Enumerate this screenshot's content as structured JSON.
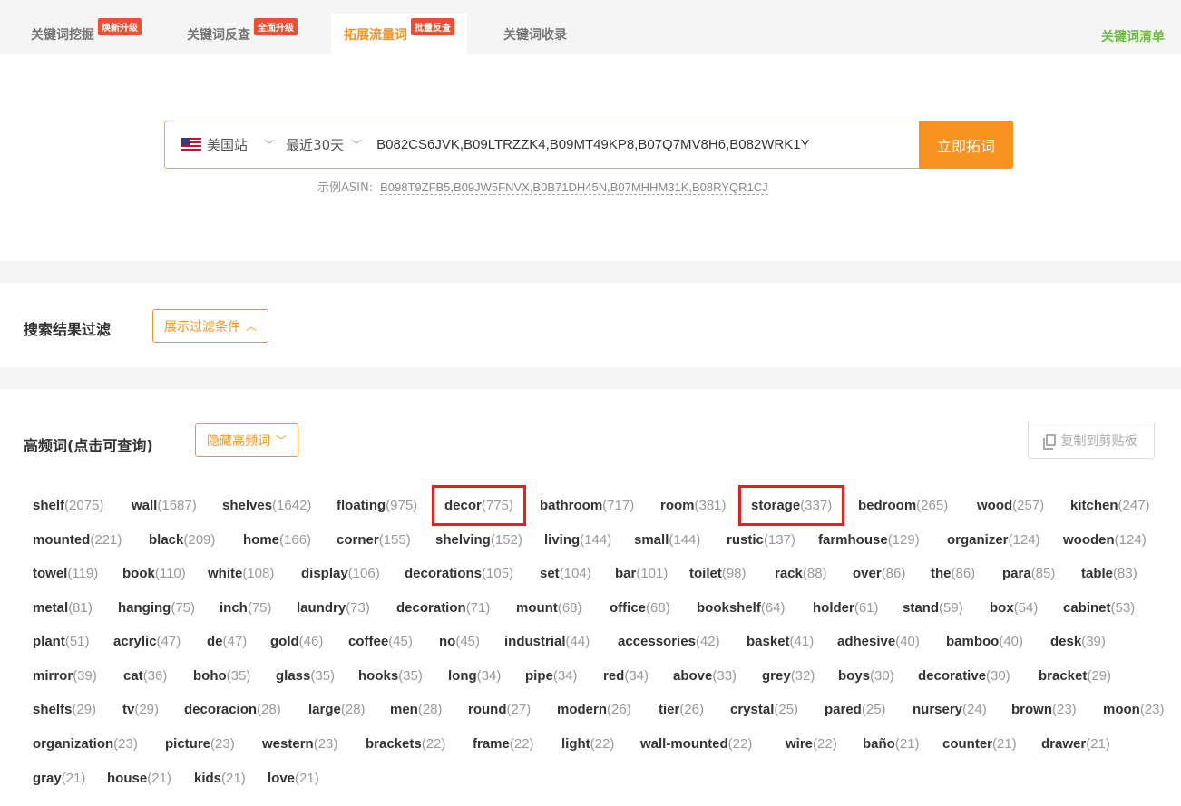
{
  "tabs": [
    {
      "label": "关键词挖掘",
      "badge": "焕新升级",
      "active": false
    },
    {
      "label": "关键词反查",
      "badge": "全面升级",
      "active": false
    },
    {
      "label": "拓展流量词",
      "badge": "批量反查",
      "active": true
    },
    {
      "label": "关键词收录",
      "badge": "",
      "active": false
    }
  ],
  "keyword_list_link": "关键词清单",
  "search": {
    "site": "美国站",
    "range": "最近30天",
    "asins": "B082CS6JVK,B09LTRZZK4,B09MT49KP8,B07Q7MV8H6,B082WRK1Y",
    "button": "立即拓词",
    "example_label": "示例ASIN:",
    "example_asins": "B098T9ZFB5,B09JW5FNVX,B0B71DH45N,B07MHHM31K,B08RYQR1CJ"
  },
  "filter": {
    "title": "搜索结果过滤",
    "toggle": "展示过滤条件"
  },
  "high_freq": {
    "title": "高频词(点击可查询)",
    "toggle": "隐藏高频词",
    "copy": "复制到剪贴板"
  },
  "colors": {
    "accent": "#f7931e",
    "badge": "#f04e2e",
    "highlight": "#e8201c",
    "link_green": "#6abf40"
  },
  "keyword_rows": [
    [
      [
        "shelf",
        "(2075)"
      ],
      [
        "wall",
        "(1687)"
      ],
      [
        "shelves",
        "(1642)"
      ],
      [
        "floating",
        "(975)"
      ],
      [
        "decor",
        "(775)"
      ],
      [
        "bathroom",
        "(717)"
      ],
      [
        "room",
        "(381)"
      ],
      [
        "storage",
        "(337)"
      ],
      [
        "bedroom",
        "(265)"
      ],
      [
        "wood",
        "(257)"
      ],
      [
        "kitchen",
        "(247)"
      ]
    ],
    [
      [
        "mounted",
        "(221)"
      ],
      [
        "black",
        "(209)"
      ],
      [
        "home",
        "(166)"
      ],
      [
        "corner",
        "(155)"
      ],
      [
        "shelving",
        "(152)"
      ],
      [
        "living",
        "(144)"
      ],
      [
        "small",
        "(144)"
      ],
      [
        "rustic",
        "(137)"
      ],
      [
        "farmhouse",
        "(129)"
      ],
      [
        "organizer",
        "(124)"
      ],
      [
        "wooden",
        "(124)"
      ]
    ],
    [
      [
        "towel",
        "(119)"
      ],
      [
        "book",
        "(110)"
      ],
      [
        "white",
        "(108)"
      ],
      [
        "display",
        "(106)"
      ],
      [
        "decorations",
        "(105)"
      ],
      [
        "set",
        "(104)"
      ],
      [
        "bar",
        "(101)"
      ],
      [
        "toilet",
        "(98)"
      ],
      [
        "rack",
        "(88)"
      ],
      [
        "over",
        "(86)"
      ],
      [
        "the",
        "(86)"
      ],
      [
        "para",
        "(85)"
      ],
      [
        "table",
        "(83)"
      ]
    ],
    [
      [
        "metal",
        "(81)"
      ],
      [
        "hanging",
        "(75)"
      ],
      [
        "inch",
        "(75)"
      ],
      [
        "laundry",
        "(73)"
      ],
      [
        "decoration",
        "(71)"
      ],
      [
        "mount",
        "(68)"
      ],
      [
        "office",
        "(68)"
      ],
      [
        "bookshelf",
        "(64)"
      ],
      [
        "holder",
        "(61)"
      ],
      [
        "stand",
        "(59)"
      ],
      [
        "box",
        "(54)"
      ],
      [
        "cabinet",
        "(53)"
      ]
    ],
    [
      [
        "plant",
        "(51)"
      ],
      [
        "acrylic",
        "(47)"
      ],
      [
        "de",
        "(47)"
      ],
      [
        "gold",
        "(46)"
      ],
      [
        "coffee",
        "(45)"
      ],
      [
        "no",
        "(45)"
      ],
      [
        "industrial",
        "(44)"
      ],
      [
        "accessories",
        "(42)"
      ],
      [
        "basket",
        "(41)"
      ],
      [
        "adhesive",
        "(40)"
      ],
      [
        "bamboo",
        "(40)"
      ],
      [
        "desk",
        "(39)"
      ]
    ],
    [
      [
        "mirror",
        "(39)"
      ],
      [
        "cat",
        "(36)"
      ],
      [
        "boho",
        "(35)"
      ],
      [
        "glass",
        "(35)"
      ],
      [
        "hooks",
        "(35)"
      ],
      [
        "long",
        "(34)"
      ],
      [
        "pipe",
        "(34)"
      ],
      [
        "red",
        "(34)"
      ],
      [
        "above",
        "(33)"
      ],
      [
        "grey",
        "(32)"
      ],
      [
        "boys",
        "(30)"
      ],
      [
        "decorative",
        "(30)"
      ],
      [
        "bracket",
        "(29)"
      ]
    ],
    [
      [
        "shelfs",
        "(29)"
      ],
      [
        "tv",
        "(29)"
      ],
      [
        "decoracion",
        "(28)"
      ],
      [
        "large",
        "(28)"
      ],
      [
        "men",
        "(28)"
      ],
      [
        "round",
        "(27)"
      ],
      [
        "modern",
        "(26)"
      ],
      [
        "tier",
        "(26)"
      ],
      [
        "crystal",
        "(25)"
      ],
      [
        "pared",
        "(25)"
      ],
      [
        "nursery",
        "(24)"
      ],
      [
        "brown",
        "(23)"
      ],
      [
        "moon",
        "(23)"
      ]
    ],
    [
      [
        "organization",
        "(23)"
      ],
      [
        "picture",
        "(23)"
      ],
      [
        "western",
        "(23)"
      ],
      [
        "brackets",
        "(22)"
      ],
      [
        "frame",
        "(22)"
      ],
      [
        "light",
        "(22)"
      ],
      [
        "wall-mounted",
        "(22)"
      ],
      [
        "wire",
        "(22)"
      ],
      [
        "baño",
        "(21)"
      ],
      [
        "counter",
        "(21)"
      ],
      [
        "drawer",
        "(21)"
      ]
    ],
    [
      [
        "gray",
        "(21)"
      ],
      [
        "house",
        "(21)"
      ],
      [
        "kids",
        "(21)"
      ],
      [
        "love",
        "(21)"
      ]
    ]
  ],
  "highlighted_keywords": [
    "decor",
    "storage"
  ]
}
